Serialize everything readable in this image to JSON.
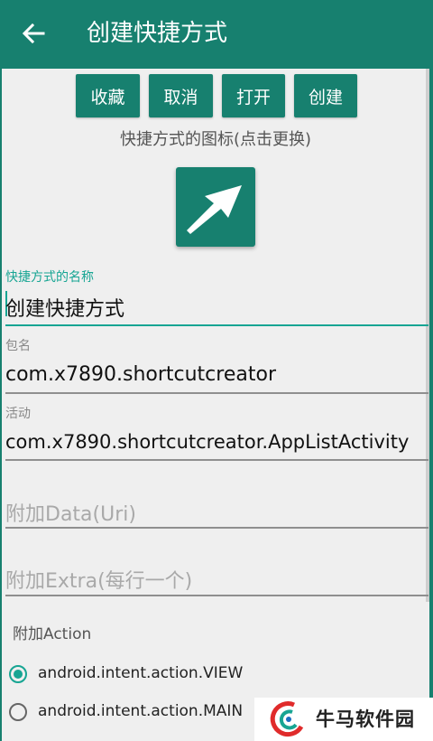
{
  "appbar": {
    "title": "创建快捷方式",
    "back_icon": "arrow-left-icon"
  },
  "toolbar": {
    "buttons": [
      {
        "label": "收藏"
      },
      {
        "label": "取消"
      },
      {
        "label": "打开"
      },
      {
        "label": "创建"
      }
    ]
  },
  "icon_hint": "快捷方式的图标(点击更换)",
  "shortcut_icon": "arrow-up-right-icon",
  "fields": {
    "name": {
      "label": "快捷方式的名称",
      "value": "创建快捷方式"
    },
    "package": {
      "label": "包名",
      "value": "com.x7890.shortcutcreator"
    },
    "activity": {
      "label": "活动",
      "value": "com.x7890.shortcutcreator.AppListActivity"
    },
    "data": {
      "placeholder": "附加Data(Uri)"
    },
    "extra": {
      "placeholder": "附加Extra(每行一个)"
    }
  },
  "action_section": {
    "label": "附加Action",
    "options": [
      {
        "label": "android.intent.action.VIEW",
        "checked": true
      },
      {
        "label": "android.intent.action.MAIN",
        "checked": false
      }
    ]
  },
  "watermark": {
    "text": "牛马软件园"
  },
  "colors": {
    "primary": "#17806f",
    "accent": "#17a593",
    "background": "#efefef"
  }
}
